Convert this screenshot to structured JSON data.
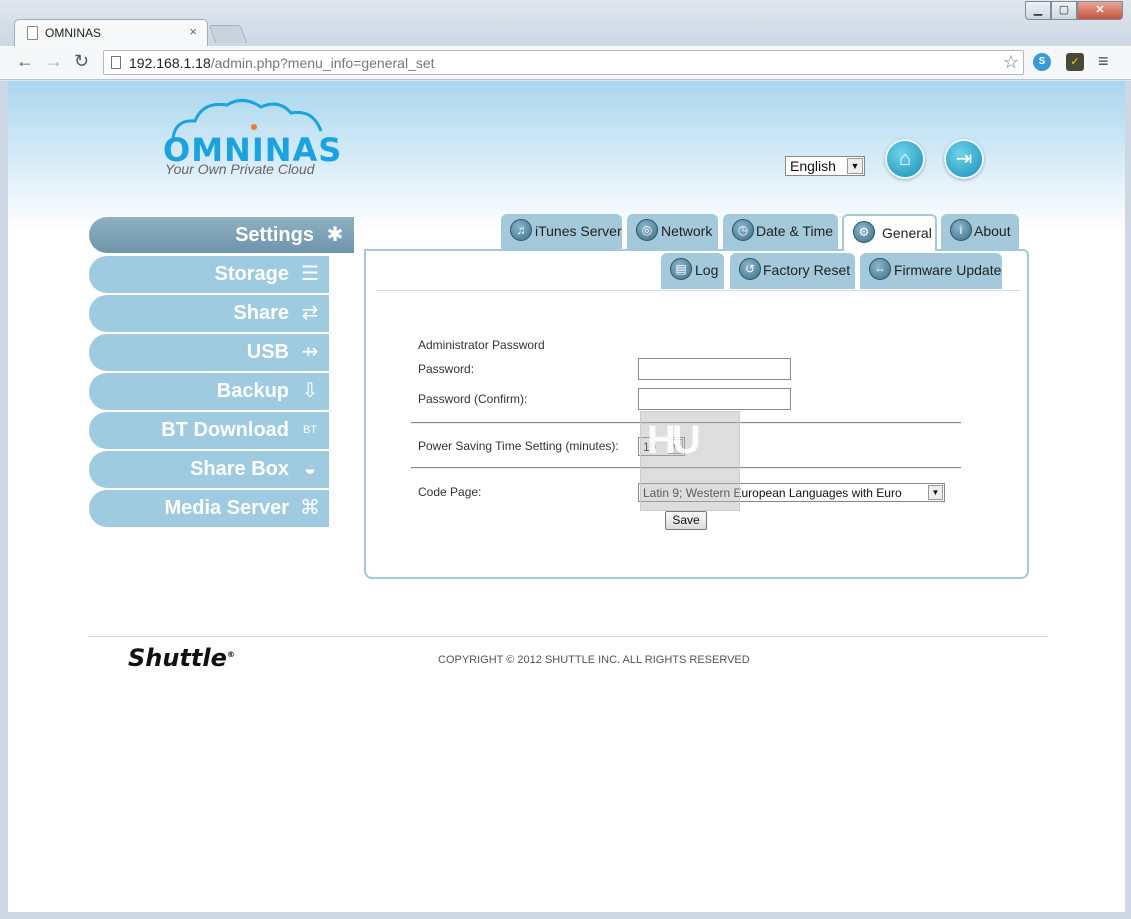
{
  "browser": {
    "tab_title": "OMNINAS",
    "tab_close": "×",
    "url_host": "192.168.1.18",
    "url_path": "/admin.php?menu_info=general_set",
    "win_min": "▁",
    "win_max": "▢",
    "win_close": "✕",
    "back": "←",
    "forward": "→",
    "reload": "↻",
    "star": "☆",
    "menu": "≡"
  },
  "header": {
    "logo_text": "OMNINAS",
    "logo_tagline": "Your Own Private Cloud",
    "language": "English",
    "home_icon": "⌂",
    "logout_icon": "⇥"
  },
  "sidebar": {
    "items": [
      {
        "label": "Settings",
        "icon": "✱"
      },
      {
        "label": "Storage",
        "icon": "☰"
      },
      {
        "label": "Share",
        "icon": "⇄"
      },
      {
        "label": "USB",
        "icon": "⇸"
      },
      {
        "label": "Backup",
        "icon": "⇩"
      },
      {
        "label": "BT Download",
        "icon": "BT"
      },
      {
        "label": "Share Box",
        "icon": "◒"
      },
      {
        "label": "Media Server",
        "icon": "⌘"
      }
    ]
  },
  "tabs": [
    {
      "label": "iTunes Server",
      "icon": "♫"
    },
    {
      "label": "Network",
      "icon": "◎"
    },
    {
      "label": "Date & Time",
      "icon": "◷"
    },
    {
      "label": "General",
      "icon": "⚙"
    },
    {
      "label": "About",
      "icon": "i"
    }
  ],
  "subtabs": [
    {
      "label": "Log",
      "icon": "▤"
    },
    {
      "label": "Factory Reset",
      "icon": "↺"
    },
    {
      "label": "Firmware Update",
      "icon": "⇔"
    }
  ],
  "form": {
    "section_title": "Administrator Password",
    "password_label": "Password:",
    "password_confirm_label": "Password (Confirm):",
    "power_saving_label": "Power Saving Time Setting (minutes):",
    "power_saving_value": "10",
    "code_page_label": "Code Page:",
    "code_page_value": "Latin 9; Western European Languages with Euro",
    "save_label": "Save",
    "dropdown_arrow": "▼"
  },
  "footer": {
    "brand": "Shuttle",
    "brand_mark": "®",
    "copyright": "COPYRIGHT © 2012 SHUTTLE INC. ALL RIGHTS RESERVED"
  }
}
